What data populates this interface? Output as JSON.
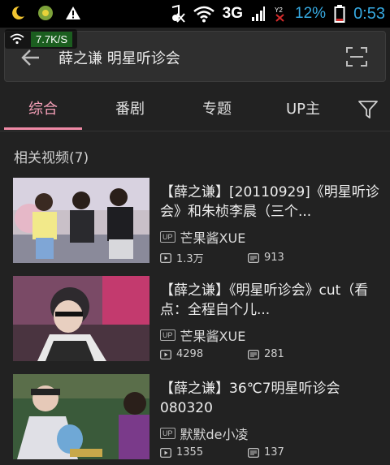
{
  "status_bar": {
    "network": "3G",
    "battery_percent": "12%",
    "time": "0:53",
    "net_speed": "7.7K/S"
  },
  "search": {
    "query": "薛之谦 明星听诊会"
  },
  "tabs": [
    {
      "label": "综合",
      "active": true
    },
    {
      "label": "番剧",
      "active": false
    },
    {
      "label": "专题",
      "active": false
    },
    {
      "label": "UP主",
      "active": false
    }
  ],
  "section": {
    "title": "相关视频(7)"
  },
  "items": [
    {
      "title": "【薛之谦】[20110929]《明星听诊会》和朱桢李晨（三个...",
      "up_badge": "UP",
      "uploader": "芒果酱XUE",
      "views": "1.3万",
      "danmaku": "913"
    },
    {
      "title": "【薛之谦】《明星听诊会》cut（看点：全程自个儿...",
      "up_badge": "UP",
      "uploader": "芒果酱XUE",
      "views": "4298",
      "danmaku": "281"
    },
    {
      "title": "【薛之谦】36℃7明星听诊会080320",
      "up_badge": "UP",
      "uploader": "默默de小凌",
      "views": "1355",
      "danmaku": "137"
    }
  ],
  "colors": {
    "accent": "#f08aa6",
    "status_blue": "#36a9e1",
    "background": "#222222"
  }
}
